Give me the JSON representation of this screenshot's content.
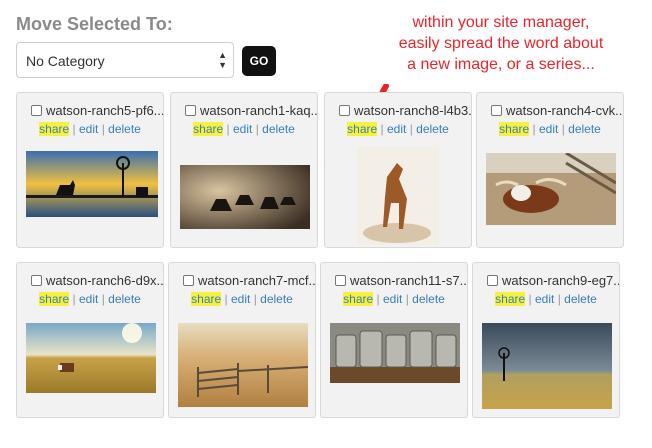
{
  "heading": "Move Selected To:",
  "category_select": {
    "value": "No Category"
  },
  "go_label": "GO",
  "annotation": [
    "within your site manager,",
    "easily spread the word about",
    "a new image, or a series..."
  ],
  "actions": {
    "share": "share",
    "sep": "|",
    "edit": "edit",
    "delete": "delete"
  },
  "cards": [
    {
      "name": "watson-ranch5-pf6..."
    },
    {
      "name": "watson-ranch1-kaq..."
    },
    {
      "name": "watson-ranch8-l4b3..."
    },
    {
      "name": "watson-ranch4-cvk..."
    },
    {
      "name": "watson-ranch6-d9x..."
    },
    {
      "name": "watson-ranch7-mcf..."
    },
    {
      "name": "watson-ranch11-s7..."
    },
    {
      "name": "watson-ranch9-eg7..."
    }
  ],
  "colors": {
    "annotation": "#e8242a",
    "link": "#3a7cc0",
    "highlight": "#f6f23c"
  }
}
